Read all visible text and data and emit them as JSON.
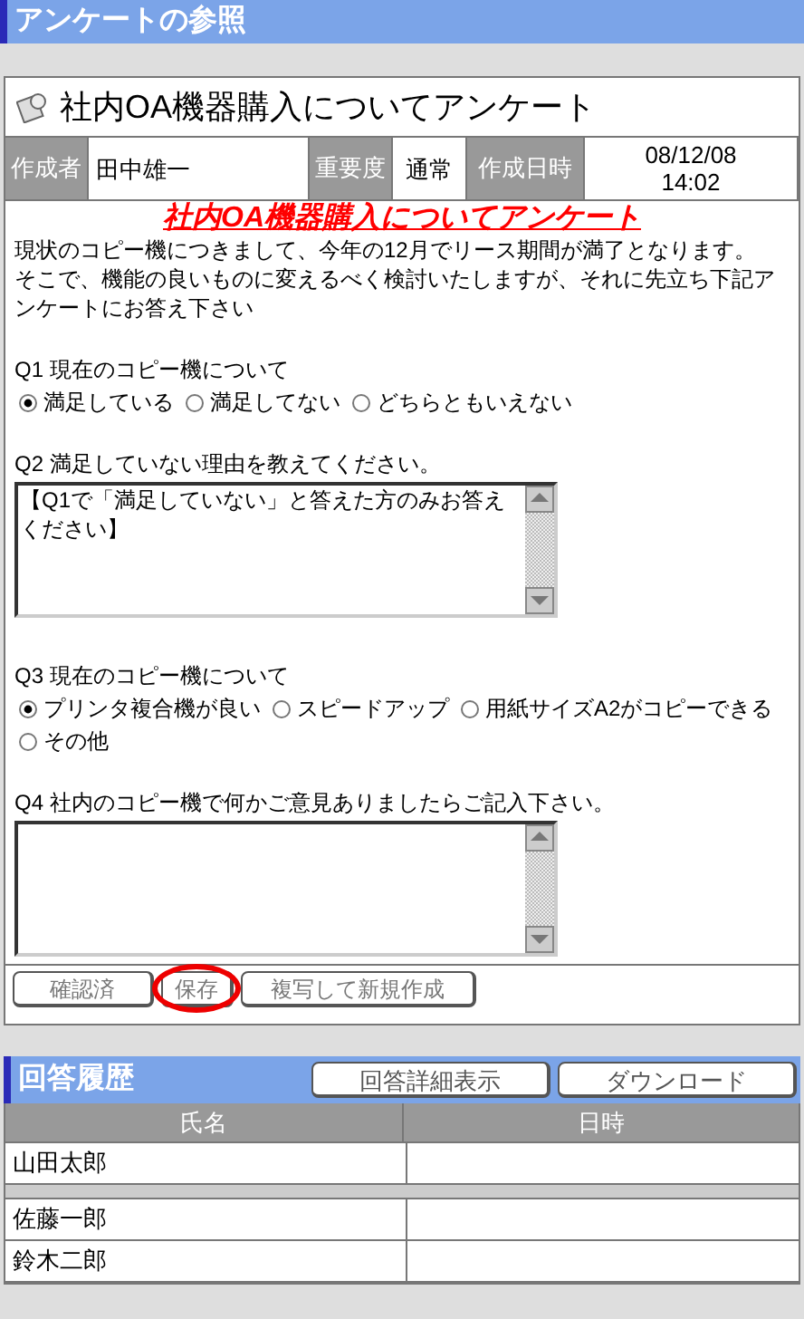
{
  "page_title": "アンケートの参照",
  "survey": {
    "title": "社内OA機器購入についてアンケート",
    "info": [
      {
        "label": "作成者",
        "value": "田中雄一"
      },
      {
        "label": "重要度",
        "value": "通常"
      },
      {
        "label": "作成日時",
        "value": "08/12/08 14:02"
      }
    ],
    "heading": "社内OA機器購入についてアンケート",
    "description": [
      "現状のコピー機につきまして、今年の12月でリース期間が満了となります。",
      "そこで、機能の良いものに変えるべく検討いたしますが、それに先立ち下記アンケートにお答え下さい"
    ],
    "questions": [
      {
        "kind": "radio",
        "label": "Q1 現在のコピー機について",
        "options": [
          {
            "label": "満足している",
            "selected": true
          },
          {
            "label": "満足してない",
            "selected": false
          },
          {
            "label": "どちらともいえない",
            "selected": false
          }
        ]
      },
      {
        "kind": "text",
        "label": "Q2 満足していない理由を教えてください。",
        "value": "【Q1で「満足していない」と答えた方のみお答えください】"
      },
      {
        "kind": "radio",
        "label": "Q3 現在のコピー機について",
        "options": [
          {
            "label": "プリンタ複合機が良い",
            "selected": true
          },
          {
            "label": "スピードアップ",
            "selected": false
          },
          {
            "label": "用紙サイズA2がコピーできる",
            "selected": false
          },
          {
            "label": "その他",
            "selected": false
          }
        ]
      },
      {
        "kind": "text",
        "label": "Q4 社内のコピー機で何かご意見ありましたらご記入下さい。"
      }
    ],
    "buttons": [
      {
        "label": "確認済",
        "disabled": true,
        "circled": false
      },
      {
        "label": "保存",
        "disabled": true,
        "circled": true
      },
      {
        "label": "複写して新規作成",
        "disabled": true,
        "circled": false
      }
    ]
  },
  "history": {
    "title": "回答履歴",
    "buttons": [
      "回答詳細表示",
      "ダウンロード"
    ],
    "columns": [
      "氏名",
      "日時"
    ],
    "rows": [
      {
        "name": "山田太郎",
        "gap_after": true
      },
      {
        "name": "佐藤一郎",
        "gap_after": false
      },
      {
        "name": "鈴木二郎",
        "gap_after": false
      }
    ]
  }
}
